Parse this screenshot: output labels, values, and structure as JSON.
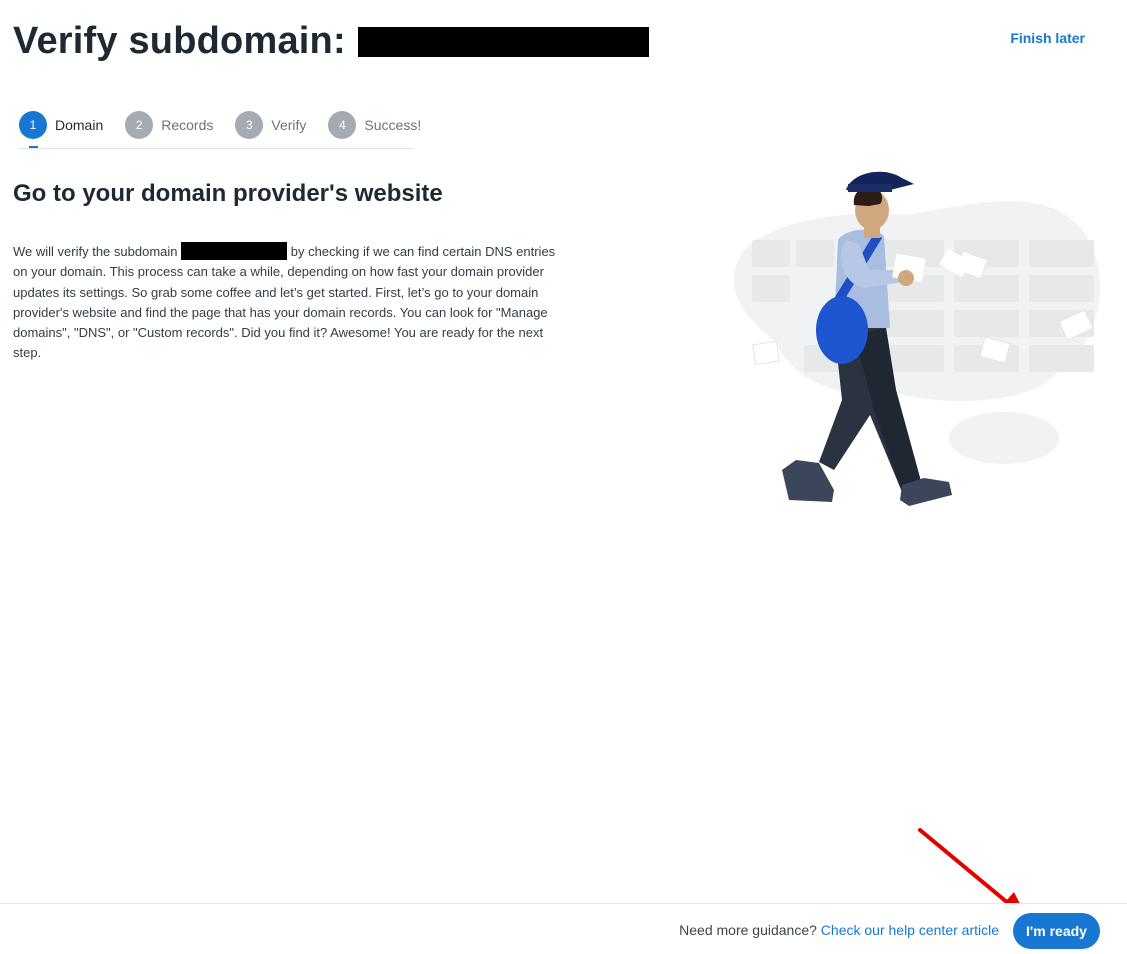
{
  "header": {
    "title": "Verify subdomain:",
    "finish_later": "Finish later"
  },
  "stepper": {
    "steps": [
      {
        "num": "1",
        "label": "Domain"
      },
      {
        "num": "2",
        "label": "Records"
      },
      {
        "num": "3",
        "label": "Verify"
      },
      {
        "num": "4",
        "label": "Success!"
      }
    ],
    "active": 0
  },
  "main": {
    "title": "Go to your domain provider's website",
    "body_before": "We will verify the subdomain ",
    "body_after": " by checking if we can find certain DNS entries on your domain. This process can take a while, depending on how fast your domain provider updates its settings. So grab some coffee and let’s get started. First, let’s go to your domain provider's website and find the page that has your domain records. You can look for \"Manage domains\", \"DNS\", or \"Custom records\". Did you find it? Awesome! You are ready for the next step."
  },
  "footer": {
    "guidance_text": "Need more guidance?",
    "help_link": "Check our help center article",
    "ready_button": "I'm ready"
  },
  "colors": {
    "accent": "#1877d2",
    "annotation_arrow": "#e50000"
  },
  "icons": [
    "mail-carrier-illustration",
    "red-pointer-arrow"
  ]
}
